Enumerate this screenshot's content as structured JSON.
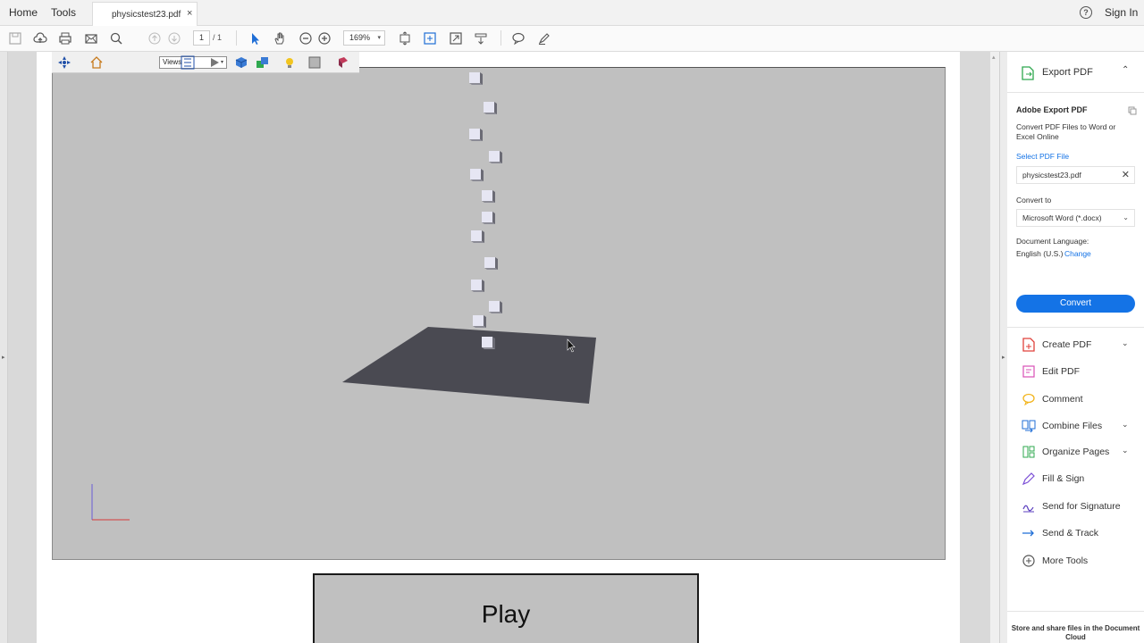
{
  "topbar": {
    "home_label": "Home",
    "tools_label": "Tools",
    "tab_title": "physicstest23.pdf",
    "tab_close": "×",
    "help_glyph": "?",
    "sign_in_label": "Sign In"
  },
  "toolbar": {
    "page_current": "1",
    "page_total": "/ 1",
    "zoom_value": "169%",
    "zoom_caret": "▾"
  },
  "viewer3d": {
    "views_value": "Views",
    "views_caret": "▾",
    "play_label": "Play",
    "floor_color": "#4a4a52",
    "cube_color": "#e6e6f3",
    "background_color": "#c0c0c0"
  },
  "right_pane": {
    "header_label": "Export PDF",
    "header_chevron": "⌃",
    "title": "Adobe Export PDF",
    "description": "Convert PDF Files to Word or Excel Online",
    "select_file_link": "Select PDF File",
    "selected_file": "physicstest23.pdf",
    "clear_glyph": "✕",
    "convert_to_label": "Convert to",
    "convert_to_value": "Microsoft Word (*.docx)",
    "convert_caret": "⌄",
    "language_label": "Document Language:",
    "language_value": "English (U.S.)",
    "language_change": "Change",
    "convert_button": "Convert",
    "accent_color": "#1473e6",
    "tools": [
      {
        "label": "Create PDF",
        "chevron": "⌄",
        "icon": "create-pdf-icon",
        "color": "#e0413b"
      },
      {
        "label": "Edit PDF",
        "chevron": "",
        "icon": "edit-pdf-icon",
        "color": "#d94fb6"
      },
      {
        "label": "Comment",
        "chevron": "",
        "icon": "comment-icon",
        "color": "#f2b51f"
      },
      {
        "label": "Combine Files",
        "chevron": "⌄",
        "icon": "combine-files-icon",
        "color": "#1f6ed6"
      },
      {
        "label": "Organize Pages",
        "chevron": "⌄",
        "icon": "organize-pages-icon",
        "color": "#2fa84f"
      },
      {
        "label": "Fill & Sign",
        "chevron": "",
        "icon": "fill-sign-icon",
        "color": "#7b4fd6"
      },
      {
        "label": "Send for Signature",
        "chevron": "",
        "icon": "send-for-signature-icon",
        "color": "#5b3fbf"
      },
      {
        "label": "Send & Track",
        "chevron": "",
        "icon": "send-track-icon",
        "color": "#1f6ed6"
      },
      {
        "label": "More Tools",
        "chevron": "",
        "icon": "more-tools-icon",
        "color": "#555555"
      }
    ],
    "footer_text": "Store and share files in the Document Cloud"
  }
}
